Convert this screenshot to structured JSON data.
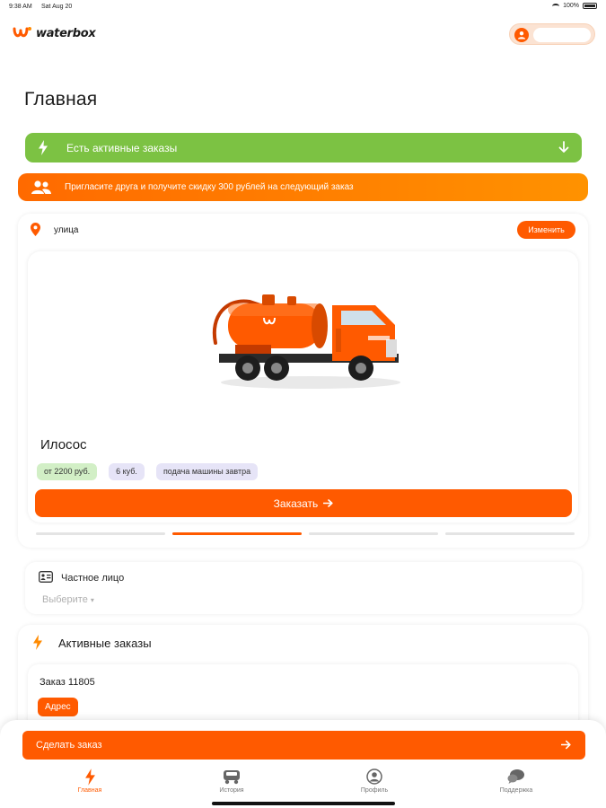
{
  "status_bar": {
    "time": "9:38 AM",
    "date": "Sat Aug 20",
    "battery": "100%"
  },
  "brand": {
    "name": "waterbox",
    "accent": "#ff5a00",
    "green": "#7cc243"
  },
  "header": {
    "profile_icon": "user-circle-icon"
  },
  "page": {
    "title": "Главная"
  },
  "active_orders_banner": {
    "label": "Есть активные заказы",
    "icon": "bolt-icon",
    "action_icon": "arrow-down-icon"
  },
  "invite_banner": {
    "label": "Пригласите друга и получите скидку 300 рублей на следующий заказ",
    "icon": "people-icon"
  },
  "address": {
    "street": "улица",
    "change_label": "Изменить",
    "icon": "location-pin-icon"
  },
  "service_card": {
    "title": "Илосос",
    "chips": [
      {
        "text": "от 2200 руб.",
        "color": "#d2efc6"
      },
      {
        "text": "6 куб.",
        "color": "#e6e4f7"
      },
      {
        "text": "подача машины завтра",
        "color": "#e6e4f7"
      }
    ],
    "order_label": "Заказать",
    "carousel": {
      "count": 4,
      "active": 1
    }
  },
  "client_type": {
    "label": "Частное лицо",
    "select_placeholder": "Выберите",
    "icon": "id-card-icon"
  },
  "active_orders": {
    "title": "Активные заказы",
    "items": [
      {
        "number": "Заказ 11805",
        "address_label": "Адрес"
      }
    ]
  },
  "bottom": {
    "make_order_label": "Сделать заказ"
  },
  "tabbar": {
    "items": [
      {
        "label": "Главная",
        "icon": "bolt-icon",
        "active": true
      },
      {
        "label": "История",
        "icon": "truck-icon",
        "active": false
      },
      {
        "label": "Профиль",
        "icon": "user-circle-icon",
        "active": false
      },
      {
        "label": "Поддержка",
        "icon": "chat-icon",
        "active": false
      }
    ]
  }
}
